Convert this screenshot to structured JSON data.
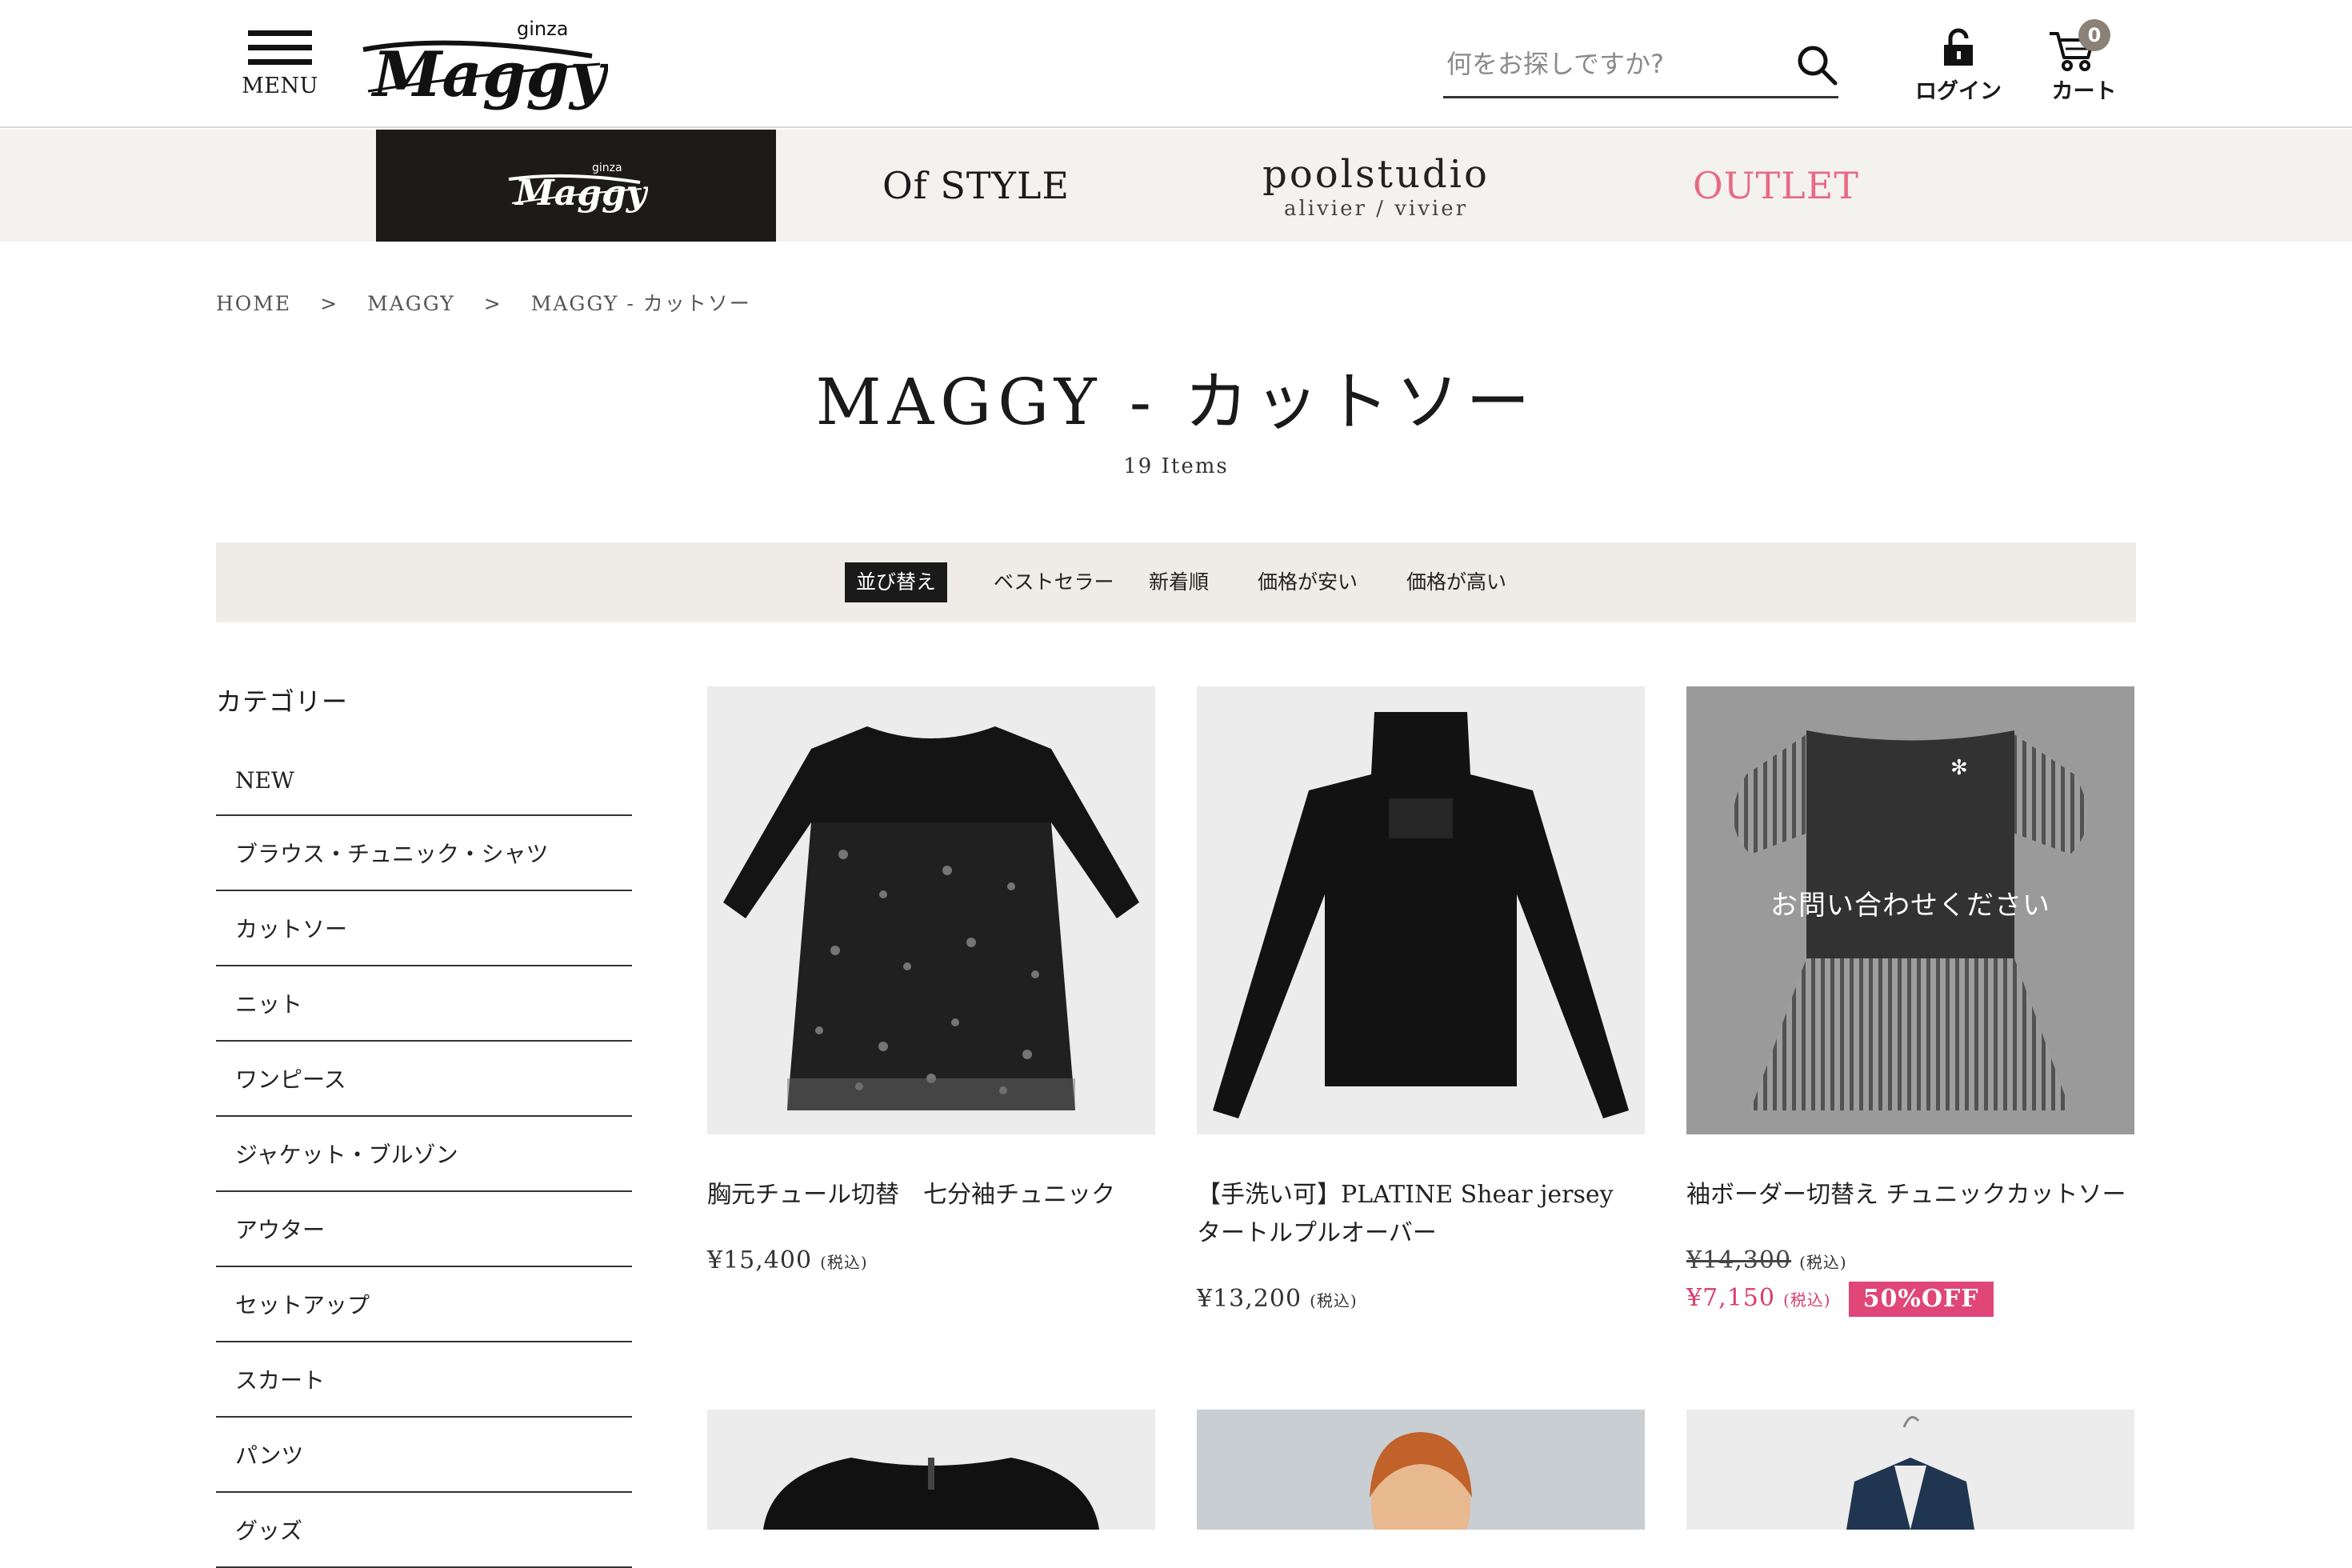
{
  "header": {
    "menu_label": "MENU",
    "logo_small": "ginza",
    "logo_main": "Maggy",
    "search_placeholder": "何をお探しですか?",
    "login_label": "ログイン",
    "cart_label": "カート",
    "cart_count": "0"
  },
  "brand_nav": {
    "maggy_small": "ginza",
    "maggy_main": "Maggy",
    "of_style": "Of STYLE",
    "pool_main": "poolstudio",
    "pool_sub": "alivier / vivier",
    "outlet": "OUTLET"
  },
  "breadcrumb": {
    "home": "HOME",
    "sep": ">",
    "maggy": "MAGGY",
    "current": "MAGGY - カットソー"
  },
  "page": {
    "title": "MAGGY - カットソー",
    "count": "19 Items"
  },
  "sort": {
    "label": "並び替え",
    "options": [
      "ベストセラー",
      "新着順",
      "価格が安い",
      "価格が高い"
    ]
  },
  "sidebar": {
    "title": "カテゴリー",
    "items": [
      "NEW",
      "ブラウス・チュニック・シャツ",
      "カットソー",
      "ニット",
      "ワンピース",
      "ジャケット・ブルゾン",
      "アウター",
      "セットアップ",
      "スカート",
      "パンツ",
      "グッズ"
    ]
  },
  "products": [
    {
      "name": "胸元チュール切替　七分袖チュニック",
      "price": "¥15,400",
      "tax": "(税込)"
    },
    {
      "name": "【手洗い可】PLATINE Shear jersey タートルプルオーバー",
      "price": "¥13,200",
      "tax": "(税込)"
    },
    {
      "name": "袖ボーダー切替え チュニックカットソー",
      "old_price": "¥14,300",
      "price": "¥7,150",
      "tax": "(税込)",
      "badge": "50%OFF",
      "overlay": "お問い合わせください"
    }
  ],
  "colors": {
    "accent_pink": "#e04677",
    "outlet_pink": "#e86a85",
    "brand_active_bg": "#1c1b19",
    "sortbar_bg": "#efebe6",
    "badge_gray": "#8b8176"
  }
}
